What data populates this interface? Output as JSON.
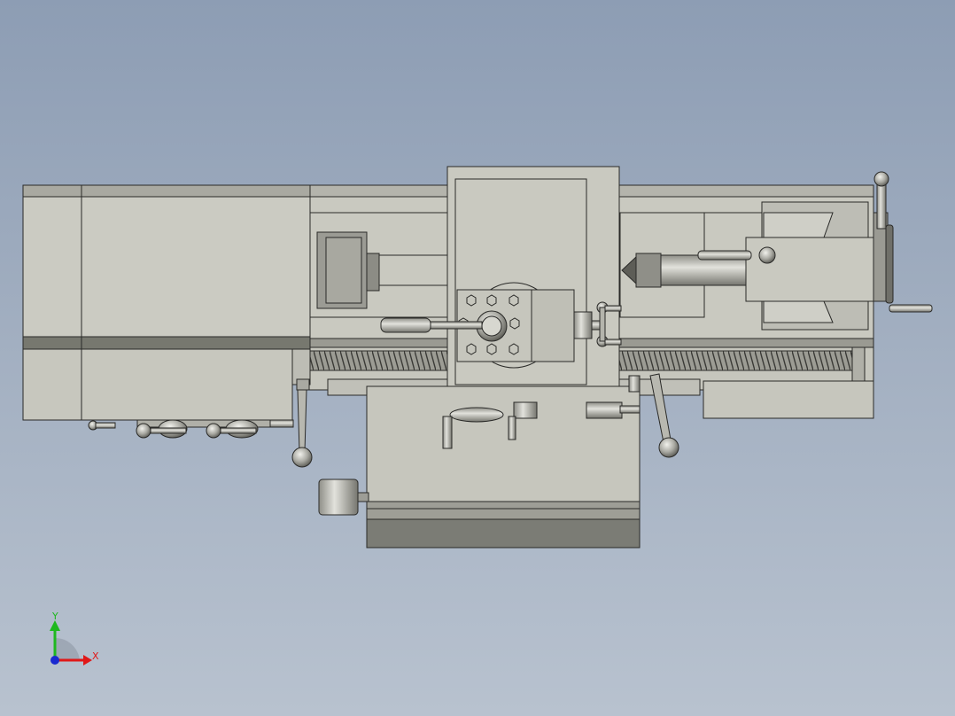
{
  "viewport": {
    "background_top": "#8d9db4",
    "background_bottom": "#b8c2cf"
  },
  "model": {
    "name": "lathe",
    "face_color": "#c8c8be",
    "shadow_color": "#7b7c75",
    "edge_color": "#2a2a28",
    "metal_color": "#b6b6ae"
  },
  "triad": {
    "x_label": "X",
    "y_label": "Y",
    "x_color": "#e01818",
    "y_color": "#1fb81f",
    "z_color": "#1a2ad0"
  }
}
